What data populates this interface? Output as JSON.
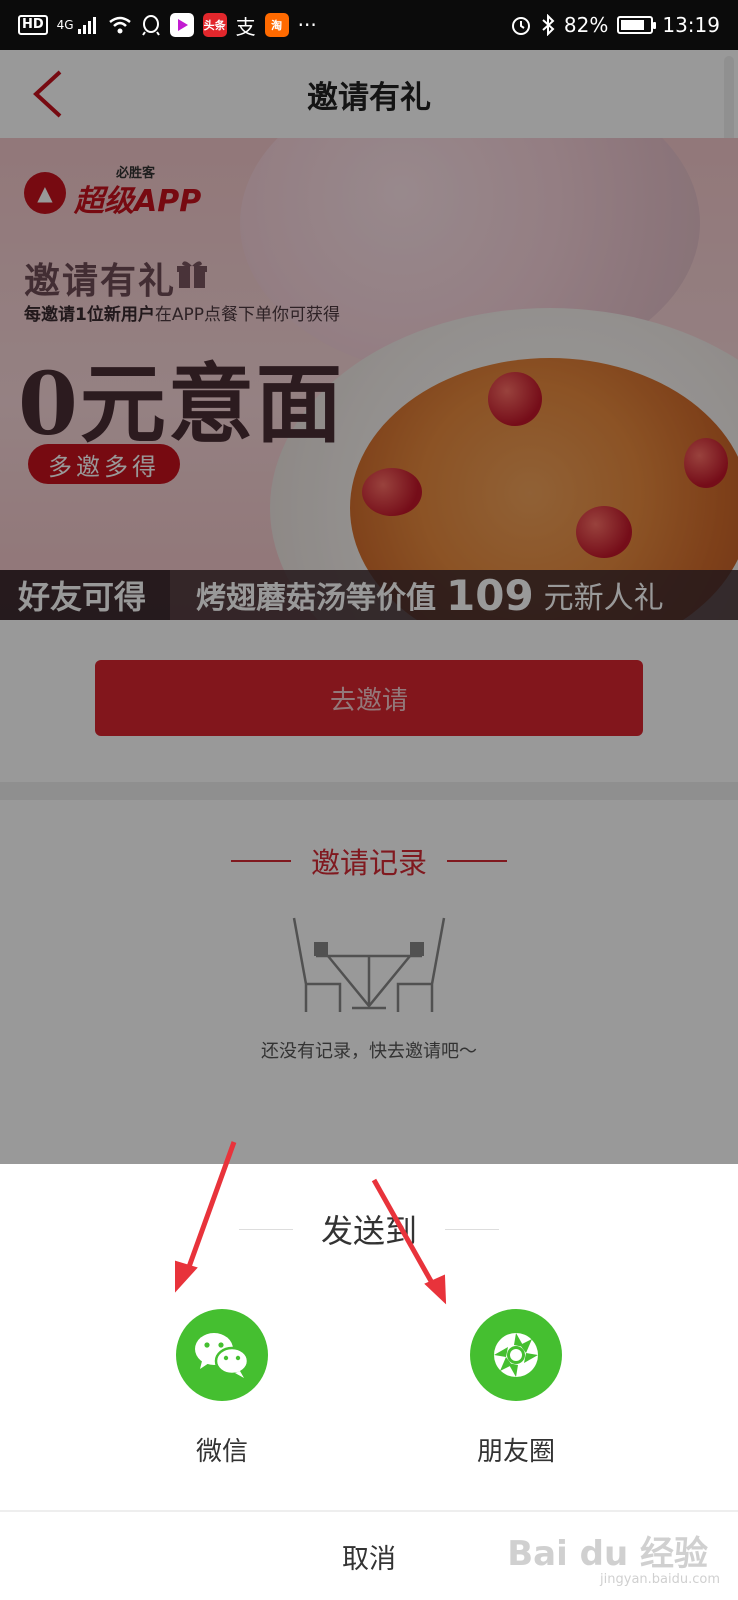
{
  "status_bar": {
    "hd": "HD",
    "network": "4G",
    "app_toutiao": "头条",
    "app_zhi": "支",
    "app_tao": "淘",
    "more": "···",
    "battery": "82%",
    "time": "13:19"
  },
  "nav": {
    "title": "邀请有礼"
  },
  "banner": {
    "brand_small": "必胜客",
    "brand": "超级APP",
    "title": "邀请有礼",
    "subtitle_bold": "每邀请1位新用户",
    "subtitle_rest": "在APP点餐下单你可获得",
    "headline": "0元意面",
    "pill": "多邀多得",
    "strip_left": "好友可得",
    "strip_main": "烤翅蘑菇汤等价值",
    "strip_value": "109",
    "strip_suffix": "元新人礼"
  },
  "invite_button": "去邀请",
  "records": {
    "title": "邀请记录",
    "empty": "还没有记录，快去邀请吧～"
  },
  "share_sheet": {
    "title": "发送到",
    "options": [
      {
        "label": "微信",
        "icon": "wechat-icon"
      },
      {
        "label": "朋友圈",
        "icon": "moments-icon"
      }
    ],
    "cancel": "取消"
  },
  "watermark": {
    "main": "Bai du 经验",
    "sub": "jingyan.baidu.com"
  },
  "colors": {
    "brand_red": "#d52a34",
    "share_green": "#45bf30",
    "annotation_red": "#e8333b"
  }
}
